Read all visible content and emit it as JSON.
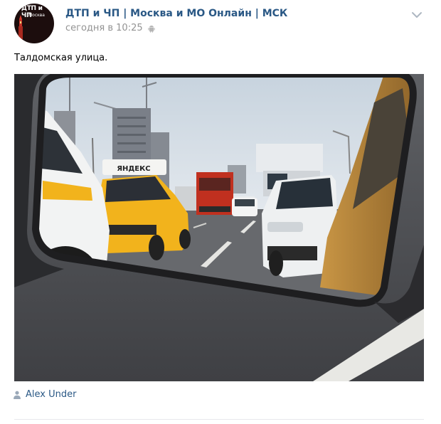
{
  "post": {
    "group_name": "ДТП и ЧП | Москва и МО Онлайн | МСК",
    "time": "сегодня в 10:25",
    "text": "Талдомская улица.",
    "author": "Alex Under",
    "avatar_logo": {
      "title": "ДТП и ЧП",
      "subtitle": "Москва"
    },
    "taxi_sign": "ЯНДЕКС",
    "icons": {
      "platform": "android-icon",
      "menu": "chevron-down-icon",
      "author": "person-icon"
    },
    "colors": {
      "link": "#2a5885",
      "meta": "#939393",
      "taxi_yellow": "#f2b31c"
    }
  }
}
